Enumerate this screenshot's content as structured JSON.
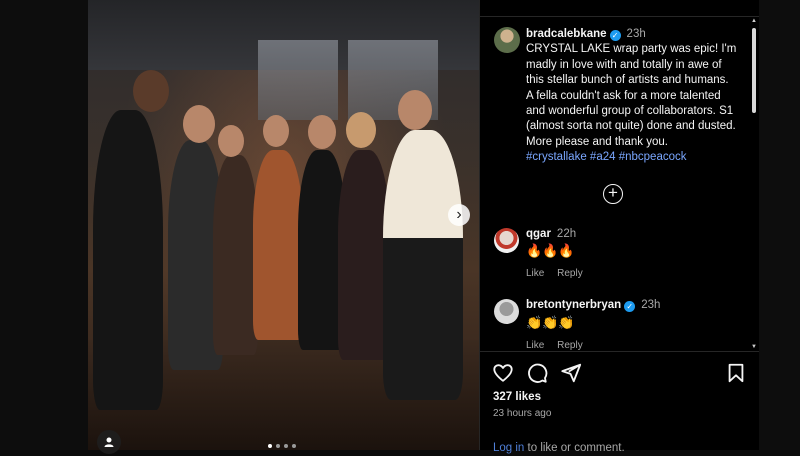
{
  "post": {
    "author": "bradcalebkane",
    "time": "23h",
    "caption": "CRYSTAL LAKE wrap party was epic! I'm madly in love with and totally in awe of this stellar bunch of artists and humans. A fella couldn't ask for a more talented and wonderful group of collaborators. S1 (almost sorta not quite) done and dusted. More please and thank you.",
    "hashtags": [
      "#crystallake",
      "#a24",
      "#nbcpeacock"
    ],
    "more_comments_icon": "plus-circle-icon"
  },
  "comments": [
    {
      "user": "qgar",
      "time": "22h",
      "text": "🔥🔥🔥",
      "verified": false,
      "like": "Like",
      "reply": "Reply"
    },
    {
      "user": "bretontynerbryan",
      "time": "23h",
      "text": "👏👏👏",
      "verified": true,
      "like": "Like",
      "reply": "Reply"
    }
  ],
  "actions": {
    "icons": [
      "heart-icon",
      "comment-icon",
      "share-icon",
      "bookmark-icon"
    ]
  },
  "likes": "327 likes",
  "posted_ago": "23 hours ago",
  "login_prompt": {
    "link": "Log in",
    "rest": " to like or comment."
  },
  "carousel": {
    "next_icon": "chevron-right-icon",
    "user_tag_icon": "person-icon",
    "current": 1,
    "total": 4
  },
  "colors": {
    "background": "#000000",
    "hashtag": "#7aa7ff",
    "verified": "#1d9bf0",
    "muted": "#a8a8a8"
  }
}
